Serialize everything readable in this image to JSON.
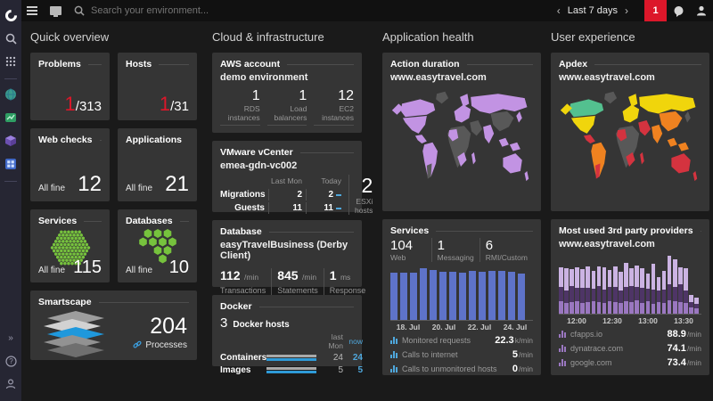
{
  "theme": {
    "bg": "#1a1a1a",
    "header_bg": "#111111",
    "sidebar_bg": "#262633",
    "tile_bg": "#353535",
    "accent_red": "#dc172a",
    "accent_blue": "#4fa8dd",
    "bar_blue": "#5e73c9",
    "green": "#76c23d",
    "violet": "#c293e3",
    "map_gray": "#585858",
    "yellow": "#f0d50c",
    "teal": "#53c08f",
    "orange": "#ef8220",
    "red": "#d4333f",
    "purple_light": "#cbb3e3",
    "purple_dark": "#4e3566",
    "purple_mid": "#9a77c0",
    "smartscape_blue": "#1f98dc"
  },
  "icons": [
    "dynatrace-logo",
    "hamburger-menu-icon",
    "monitor-icon",
    "search-icon",
    "apps-grid-icon",
    "globe-icon",
    "synthetic-icon",
    "smartscape-cube-icon",
    "hosts-grid-icon",
    "expand-icon",
    "help-icon",
    "user-icon",
    "chevron-left-icon",
    "chevron-right-icon",
    "chat-icon",
    "link-icon",
    "mini-chart-icon"
  ],
  "topbar": {
    "search_placeholder": "Search your environment...",
    "time_range": "Last 7 days",
    "problems_badge": "1"
  },
  "columns": {
    "quick": {
      "title": "Quick overview",
      "problems": {
        "label": "Problems",
        "value_red": "1",
        "value_rest": "/313"
      },
      "hosts": {
        "label": "Hosts",
        "value_red": "1",
        "value_rest": "/31"
      },
      "web_checks": {
        "label": "Web checks",
        "status": "All fine",
        "value": "12"
      },
      "applications": {
        "label": "Applications",
        "status": "All fine",
        "value": "21"
      },
      "services": {
        "label": "Services",
        "status": "All fine",
        "value": "115"
      },
      "databases": {
        "label": "Databases",
        "status": "All fine",
        "value": "10"
      },
      "smartscape": {
        "label": "Smartscape",
        "value": "204",
        "unit": "Processes"
      }
    },
    "cloud": {
      "title": "Cloud & infrastructure",
      "aws": {
        "label": "AWS account",
        "subtitle": "demo environment",
        "stats": [
          {
            "value": "1",
            "caption1": "RDS",
            "caption2": "instances"
          },
          {
            "value": "1",
            "caption1": "Load",
            "caption2": "balancers"
          },
          {
            "value": "12",
            "caption1": "EC2",
            "caption2": "instances"
          }
        ]
      },
      "vmware": {
        "label": "VMware vCenter",
        "subtitle": "emea-gdn-vc002",
        "col1": "Last Mon",
        "col2": "Today",
        "rows": [
          {
            "name": "Migrations",
            "last": "2",
            "today": "2"
          },
          {
            "name": "Guests",
            "last": "11",
            "today": "11"
          }
        ],
        "big_value": "2",
        "big_unit": "ESXi hosts"
      },
      "database": {
        "label": "Database",
        "subtitle": "easyTravelBusiness (Derby Client)",
        "stats": [
          {
            "value": "112",
            "unit": "/min",
            "caption": "Transactions"
          },
          {
            "value": "845",
            "unit": "/min",
            "caption": "Statements"
          },
          {
            "value": "1",
            "unit": "ms",
            "caption": "Response time"
          }
        ]
      },
      "docker": {
        "label": "Docker",
        "hosts_value": "3",
        "hosts_label": "Docker hosts",
        "col1": "last Mon",
        "col2": "now",
        "rows": [
          {
            "name": "Containers",
            "last": "24",
            "now": "24",
            "bar": 100
          },
          {
            "name": "Images",
            "last": "5",
            "now": "5",
            "bar": 100
          }
        ]
      }
    },
    "app_health": {
      "title": "Application health",
      "action_duration": {
        "label": "Action duration",
        "subtitle": "www.easytravel.com"
      },
      "services": {
        "label": "Services",
        "stats": [
          {
            "value": "104",
            "caption": "Web"
          },
          {
            "value": "1",
            "caption": "Messaging"
          },
          {
            "value": "6",
            "caption": "RMI/Custom"
          }
        ],
        "chart": {
          "type": "bar",
          "values": [
            88,
            88,
            89,
            97,
            93,
            90,
            90,
            89,
            91,
            90,
            91,
            91,
            90,
            86
          ],
          "x_labels": [
            "18. Jul",
            "20. Jul",
            "22. Jul",
            "24. Jul"
          ]
        },
        "rows": [
          {
            "label": "Monitored requests",
            "value": "22.3",
            "unit": "k/min"
          },
          {
            "label": "Calls to internet",
            "value": "5",
            "unit": "/min"
          },
          {
            "label": "Calls to unmonitored hosts",
            "value": "0",
            "unit": "/min"
          }
        ]
      }
    },
    "user_exp": {
      "title": "User experience",
      "apdex": {
        "label": "Apdex",
        "subtitle": "www.easytravel.com"
      },
      "providers": {
        "label": "Most used 3rd party providers",
        "subtitle": "www.easytravel.com",
        "chart": {
          "type": "stacked-bar",
          "x_labels": [
            "12:00",
            "12:30",
            "13:00",
            "13:30"
          ],
          "series": [
            {
              "name": "bottom",
              "values": [
                14,
                12,
                13,
                14,
                12,
                13,
                14,
                13,
                12,
                14,
                13,
                12,
                14,
                13,
                15,
                12,
                14,
                11,
                13,
                12,
                15,
                14,
                13,
                12,
                7,
                6
              ]
            },
            {
              "name": "middle",
              "values": [
                16,
                14,
                18,
                15,
                17,
                16,
                14,
                18,
                15,
                16,
                17,
                14,
                16,
                18,
                15,
                17,
                14,
                16,
                13,
                15,
                18,
                16,
                20,
                14,
                6,
                5
              ]
            },
            {
              "name": "top",
              "values": [
                22,
                25,
                19,
                23,
                21,
                24,
                20,
                22,
                25,
                19,
                23,
                21,
                27,
                20,
                24,
                22,
                17,
                29,
                15,
                21,
                32,
                31,
                19,
                25,
                8,
                7
              ]
            }
          ]
        },
        "rows": [
          {
            "label": "cfapps.io",
            "value": "88.9",
            "unit": "/min"
          },
          {
            "label": "dynatrace.com",
            "value": "74.1",
            "unit": "/min"
          },
          {
            "label": "google.com",
            "value": "73.4",
            "unit": "/min"
          }
        ]
      }
    }
  },
  "maps": {
    "action": {
      "alaska": "#c293e3",
      "canada": "#c293e3",
      "us": "#c293e3",
      "greenland": "#585858",
      "central_america": "#c293e3",
      "south_america": "#c293e3",
      "s_cone": "#585858",
      "europe": "#c293e3",
      "scandinavia": "#c293e3",
      "africa": "#585858",
      "west_africa": "#c293e3",
      "south_africa": "#c293e3",
      "madagascar": "#c293e3",
      "russia": "#c293e3",
      "east_russia": "#c293e3",
      "middle_east": "#585858",
      "india": "#c293e3",
      "east_asia": "#585858",
      "se_asia": "#c293e3",
      "indonesia": "#c293e3",
      "japan": "#c293e3",
      "australia": "#c293e3",
      "nz": "#c293e3"
    },
    "apdex": {
      "alaska": "#f0d50c",
      "canada": "#53c08f",
      "us": "#f0d50c",
      "greenland": "#585858",
      "central_america": "#d4333f",
      "south_america": "#ef8220",
      "s_cone": "#d4333f",
      "europe": "#f0d50c",
      "scandinavia": "#f0d50c",
      "africa": "#585858",
      "west_africa": "#d4333f",
      "south_africa": "#d4333f",
      "madagascar": "#d4333f",
      "russia": "#f0d50c",
      "east_russia": "#f0d50c",
      "middle_east": "#d4333f",
      "india": "#ef8220",
      "east_asia": "#ef8220",
      "se_asia": "#ef8220",
      "indonesia": "#ef8220",
      "japan": "#585858",
      "australia": "#d4333f",
      "nz": "#d4333f"
    }
  }
}
